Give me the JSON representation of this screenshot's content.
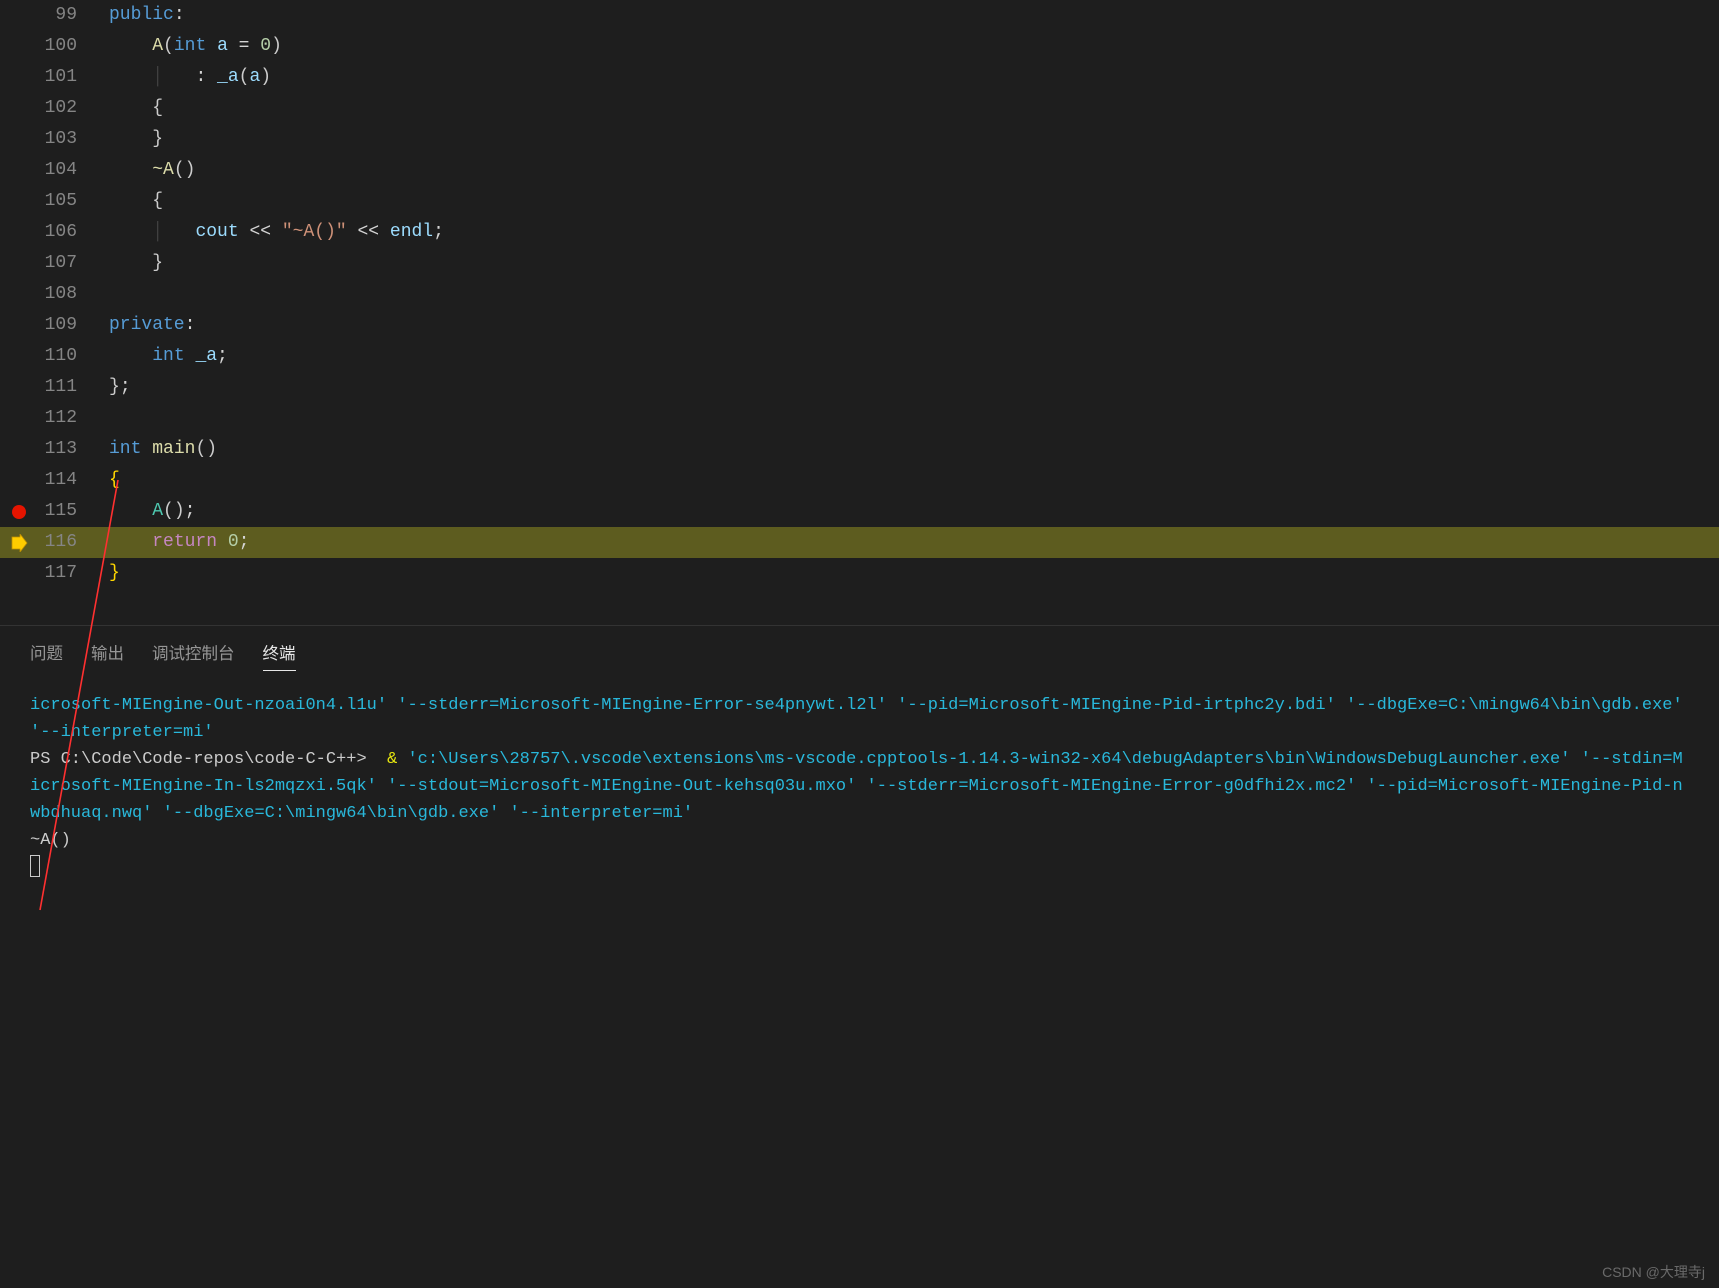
{
  "editor": {
    "lines": [
      {
        "num": "99",
        "tokens": [
          {
            "t": "public",
            "c": "k-public"
          },
          {
            "t": ":",
            "c": "punct"
          }
        ]
      },
      {
        "num": "100",
        "tokens": [
          {
            "t": "    ",
            "c": ""
          },
          {
            "t": "A",
            "c": "fn-name"
          },
          {
            "t": "(",
            "c": "paren"
          },
          {
            "t": "int",
            "c": "k-int"
          },
          {
            "t": " ",
            "c": ""
          },
          {
            "t": "a",
            "c": "ident"
          },
          {
            "t": " = ",
            "c": "op"
          },
          {
            "t": "0",
            "c": "num"
          },
          {
            "t": ")",
            "c": "paren"
          }
        ]
      },
      {
        "num": "101",
        "tokens": [
          {
            "t": "    ",
            "c": ""
          },
          {
            "t": "│   ",
            "c": "indent-guide"
          },
          {
            "t": ": ",
            "c": "punct"
          },
          {
            "t": "_a",
            "c": "ident"
          },
          {
            "t": "(",
            "c": "paren"
          },
          {
            "t": "a",
            "c": "ident"
          },
          {
            "t": ")",
            "c": "paren"
          }
        ]
      },
      {
        "num": "102",
        "tokens": [
          {
            "t": "    ",
            "c": ""
          },
          {
            "t": "{",
            "c": "brace"
          }
        ]
      },
      {
        "num": "103",
        "tokens": [
          {
            "t": "    ",
            "c": ""
          },
          {
            "t": "}",
            "c": "brace"
          }
        ]
      },
      {
        "num": "104",
        "tokens": [
          {
            "t": "    ",
            "c": ""
          },
          {
            "t": "~A",
            "c": "fn-name"
          },
          {
            "t": "()",
            "c": "paren"
          }
        ]
      },
      {
        "num": "105",
        "tokens": [
          {
            "t": "    ",
            "c": ""
          },
          {
            "t": "{",
            "c": "brace"
          }
        ]
      },
      {
        "num": "106",
        "tokens": [
          {
            "t": "    ",
            "c": ""
          },
          {
            "t": "│   ",
            "c": "indent-guide"
          },
          {
            "t": "cout",
            "c": "ident"
          },
          {
            "t": " << ",
            "c": "op"
          },
          {
            "t": "\"~A()\"",
            "c": "str"
          },
          {
            "t": " << ",
            "c": "op"
          },
          {
            "t": "endl",
            "c": "ident"
          },
          {
            "t": ";",
            "c": "punct"
          }
        ]
      },
      {
        "num": "107",
        "tokens": [
          {
            "t": "    ",
            "c": ""
          },
          {
            "t": "}",
            "c": "brace"
          }
        ]
      },
      {
        "num": "108",
        "tokens": []
      },
      {
        "num": "109",
        "tokens": [
          {
            "t": "private",
            "c": "k-private"
          },
          {
            "t": ":",
            "c": "punct"
          }
        ]
      },
      {
        "num": "110",
        "tokens": [
          {
            "t": "    ",
            "c": ""
          },
          {
            "t": "int",
            "c": "k-int"
          },
          {
            "t": " ",
            "c": ""
          },
          {
            "t": "_a",
            "c": "ident"
          },
          {
            "t": ";",
            "c": "punct"
          }
        ]
      },
      {
        "num": "111",
        "tokens": [
          {
            "t": "}",
            "c": "brace"
          },
          {
            "t": ";",
            "c": "punct"
          }
        ]
      },
      {
        "num": "112",
        "tokens": []
      },
      {
        "num": "113",
        "tokens": [
          {
            "t": "int",
            "c": "k-int"
          },
          {
            "t": " ",
            "c": ""
          },
          {
            "t": "main",
            "c": "fn-name"
          },
          {
            "t": "()",
            "c": "paren"
          }
        ]
      },
      {
        "num": "114",
        "tokens": [
          {
            "t": "{",
            "c": "brace-yellow"
          }
        ]
      },
      {
        "num": "115",
        "breakpoint": true,
        "tokens": [
          {
            "t": "    ",
            "c": ""
          },
          {
            "t": "A",
            "c": "class-name"
          },
          {
            "t": "()",
            "c": "paren"
          },
          {
            "t": ";",
            "c": "punct"
          }
        ]
      },
      {
        "num": "116",
        "current": true,
        "highlighted": true,
        "tokens": [
          {
            "t": "    ",
            "c": ""
          },
          {
            "t": "return",
            "c": "k-return"
          },
          {
            "t": " ",
            "c": ""
          },
          {
            "t": "0",
            "c": "num"
          },
          {
            "t": ";",
            "c": "punct"
          }
        ]
      },
      {
        "num": "117",
        "tokens": [
          {
            "t": "}",
            "c": "brace-yellow"
          }
        ]
      }
    ]
  },
  "panel": {
    "tabs": [
      {
        "label": "问题",
        "active": false
      },
      {
        "label": "输出",
        "active": false
      },
      {
        "label": "调试控制台",
        "active": false
      },
      {
        "label": "终端",
        "active": true
      }
    ],
    "terminal": {
      "segments": [
        {
          "text": "icrosoft-MIEngine-Out-nzoai0n4.l1u'",
          "c": "term-cyan"
        },
        {
          "text": " ",
          "c": "term-white"
        },
        {
          "text": "'--stderr=Microsoft-MIEngine-Error-se4pnywt.l2l'",
          "c": "term-cyan"
        },
        {
          "text": " ",
          "c": "term-white"
        },
        {
          "text": "'--pid=Microsoft-MIEngine-Pid-irtphc2y.bdi'",
          "c": "term-cyan"
        },
        {
          "text": " ",
          "c": "term-white"
        },
        {
          "text": "'--dbgExe=C:\\mingw64\\bin\\gdb.exe'",
          "c": "term-cyan"
        },
        {
          "text": " ",
          "c": "term-white"
        },
        {
          "text": "'--interpreter=mi'",
          "c": "term-cyan"
        },
        {
          "text": "\n",
          "c": ""
        },
        {
          "text": "PS C:\\Code\\Code-repos\\code-C-C++> ",
          "c": "term-white"
        },
        {
          "text": " ",
          "c": ""
        },
        {
          "text": "&",
          "c": "term-yellow"
        },
        {
          "text": " ",
          "c": ""
        },
        {
          "text": "'c:\\Users\\28757\\.vscode\\extensions\\ms-vscode.cpptools-1.14.3-win32-x64\\debugAdapters\\bin\\WindowsDebugLauncher.exe'",
          "c": "term-cyan"
        },
        {
          "text": " ",
          "c": "term-white"
        },
        {
          "text": "'--stdin=Microsoft-MIEngine-In-ls2mqzxi.5qk'",
          "c": "term-cyan"
        },
        {
          "text": " ",
          "c": "term-white"
        },
        {
          "text": "'--stdout=Microsoft-MIEngine-Out-kehsq03u.mxo'",
          "c": "term-cyan"
        },
        {
          "text": " ",
          "c": "term-white"
        },
        {
          "text": "'--stderr=Microsoft-MIEngine-Error-g0dfhi2x.mc2'",
          "c": "term-cyan"
        },
        {
          "text": " ",
          "c": "term-white"
        },
        {
          "text": "'--pid=Microsoft-MIEngine-Pid-nwbdhuaq.nwq'",
          "c": "term-cyan"
        },
        {
          "text": " ",
          "c": "term-white"
        },
        {
          "text": "'--dbgExe=C:\\mingw64\\bin\\gdb.exe'",
          "c": "term-cyan"
        },
        {
          "text": " ",
          "c": "term-white"
        },
        {
          "text": "'--interpreter=mi'",
          "c": "term-cyan"
        },
        {
          "text": "\n",
          "c": ""
        },
        {
          "text": "~A()",
          "c": "term-white"
        }
      ]
    }
  },
  "watermark": "CSDN @大理寺j"
}
